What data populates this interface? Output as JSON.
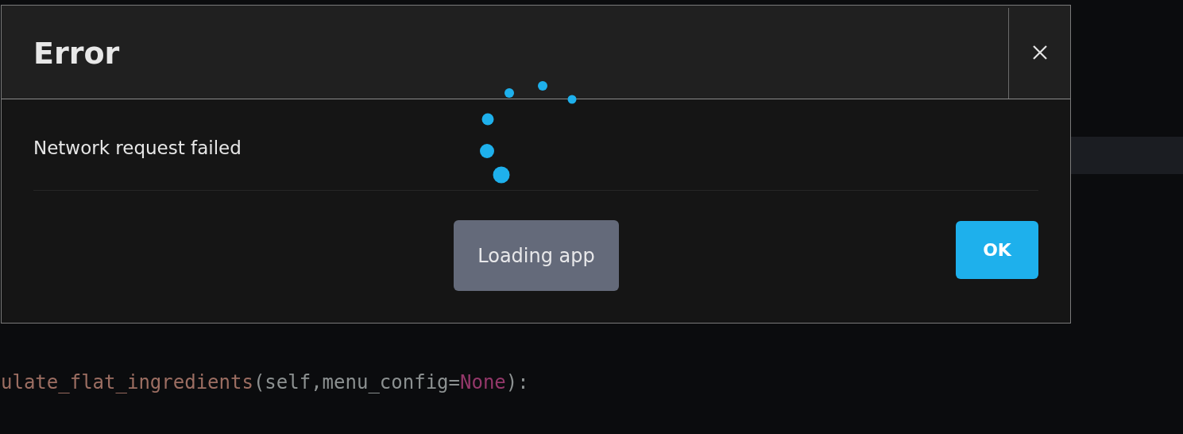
{
  "dialog": {
    "title": "Error",
    "message": "Network request failed",
    "buttons": [
      {
        "label": "OK",
        "kind": "primary"
      }
    ]
  },
  "loading": {
    "label": "Loading app"
  },
  "code_line": {
    "tokens": [
      {
        "text": "ulate_flat_ingredients",
        "kind": "function"
      },
      {
        "text": "(self,menu_config=",
        "kind": "plain"
      },
      {
        "text": "None",
        "kind": "keyword"
      },
      {
        "text": "):",
        "kind": "plain"
      }
    ]
  }
}
